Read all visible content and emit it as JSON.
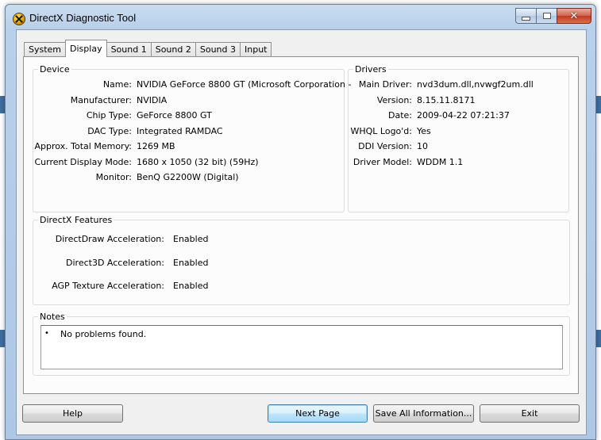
{
  "window": {
    "title": "DirectX Diagnostic Tool"
  },
  "tabs": [
    {
      "label": "System"
    },
    {
      "label": "Display"
    },
    {
      "label": "Sound 1"
    },
    {
      "label": "Sound 2"
    },
    {
      "label": "Sound 3"
    },
    {
      "label": "Input"
    }
  ],
  "device": {
    "title": "Device",
    "rows": [
      {
        "label": "Name:",
        "value": "NVIDIA GeForce 8800 GT (Microsoft Corporation -"
      },
      {
        "label": "Manufacturer:",
        "value": "NVIDIA"
      },
      {
        "label": "Chip Type:",
        "value": "GeForce 8800 GT"
      },
      {
        "label": "DAC Type:",
        "value": "Integrated RAMDAC"
      },
      {
        "label": "Approx. Total Memory:",
        "value": "1269 MB"
      },
      {
        "label": "Current Display Mode:",
        "value": "1680 x 1050 (32 bit) (59Hz)"
      },
      {
        "label": "Monitor:",
        "value": "BenQ G2200W (Digital)"
      }
    ]
  },
  "drivers": {
    "title": "Drivers",
    "rows": [
      {
        "label": "Main Driver:",
        "value": "nvd3dum.dll,nvwgf2um.dll"
      },
      {
        "label": "Version:",
        "value": "8.15.11.8171"
      },
      {
        "label": "Date:",
        "value": "2009-04-22 07:21:37"
      },
      {
        "label": "WHQL Logo'd:",
        "value": "Yes"
      },
      {
        "label": "DDI Version:",
        "value": "10"
      },
      {
        "label": "Driver Model:",
        "value": "WDDM 1.1"
      }
    ]
  },
  "features": {
    "title": "DirectX Features",
    "rows": [
      {
        "label": "DirectDraw Acceleration:",
        "value": "Enabled"
      },
      {
        "label": "Direct3D Acceleration:",
        "value": "Enabled"
      },
      {
        "label": "AGP Texture Acceleration:",
        "value": "Enabled"
      }
    ]
  },
  "notes": {
    "title": "Notes",
    "bullet": "•",
    "text": "No problems found."
  },
  "buttons": {
    "help": "Help",
    "next_page": "Next Page",
    "save_all": "Save All Information...",
    "exit": "Exit"
  },
  "colors": {
    "frame": "#b9d0ea",
    "close_button": "#c13a22",
    "default_button": "#3c7fb1"
  },
  "icons": {
    "app": "directx-x-icon",
    "minimize": "minimize-icon",
    "maximize": "maximize-icon",
    "close": "close-icon"
  }
}
